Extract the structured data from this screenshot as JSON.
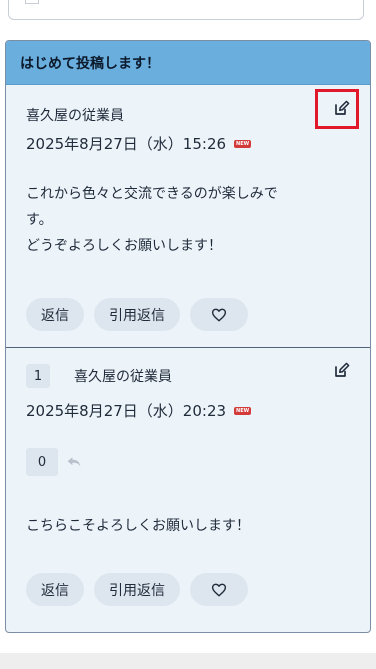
{
  "thread": {
    "title": "はじめて投稿します！",
    "posts": [
      {
        "author": "喜久屋の従業員",
        "date": "2025年8月27日（水）15:26",
        "new_label": "NEW",
        "body": [
          "これから色々と交流できるのが楽しみで",
          "す。",
          "どうぞよろしくお願いします！"
        ],
        "actions": {
          "reply": "返信",
          "quote": "引用返信"
        }
      },
      {
        "number": "1",
        "author": "喜久屋の従業員",
        "date": "2025年8月27日（水）20:23",
        "new_label": "NEW",
        "reply_count": "0",
        "body": [
          "こちらこそよろしくお願いします！"
        ],
        "actions": {
          "reply": "返信",
          "quote": "引用返信"
        }
      }
    ]
  },
  "colors": {
    "header_bg": "#6aaede",
    "highlight_border": "#e0182a",
    "new_badge": "#d33a3a"
  }
}
